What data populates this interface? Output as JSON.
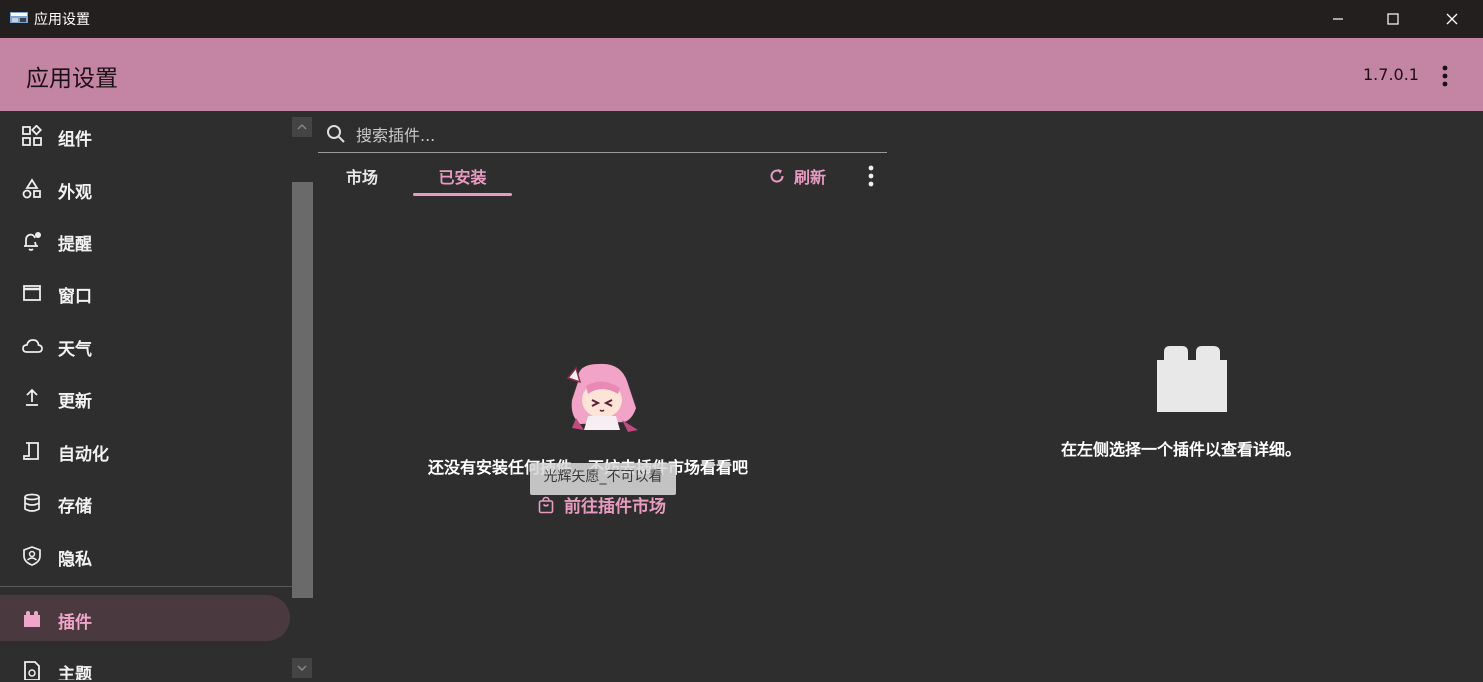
{
  "window": {
    "title": "应用设置"
  },
  "header": {
    "title": "应用设置",
    "version": "1.7.0.1"
  },
  "sidebar": {
    "items": [
      {
        "label": "组件"
      },
      {
        "label": "外观"
      },
      {
        "label": "提醒"
      },
      {
        "label": "窗口"
      },
      {
        "label": "天气"
      },
      {
        "label": "更新"
      },
      {
        "label": "自动化"
      },
      {
        "label": "存储"
      },
      {
        "label": "隐私"
      },
      {
        "label": "插件",
        "active": true
      },
      {
        "label": "主题"
      }
    ]
  },
  "search": {
    "placeholder": "搜索插件..."
  },
  "tabs": [
    {
      "label": "市场"
    },
    {
      "label": "已安装",
      "active": true
    }
  ],
  "toolbar": {
    "refresh_label": "刷新"
  },
  "empty_state": {
    "message": "还没有安装任何插件，不妨去插件市场看看吧",
    "action_label": "前往插件市场",
    "tooltip": "光辉矢愿_不可以看"
  },
  "details": {
    "hint": "在左侧选择一个插件以查看详细。"
  },
  "colors": {
    "accent": "#e89bc0",
    "header_bg": "#c485a5",
    "background": "#2e2e2e",
    "titlebar": "#241f1f"
  },
  "icons": [
    "app-icon",
    "minimize-icon",
    "maximize-icon",
    "close-icon",
    "more-vert-icon",
    "widgets-icon",
    "appearance-icon",
    "notification-icon",
    "window-icon",
    "cloud-icon",
    "update-icon",
    "automation-icon",
    "storage-icon",
    "privacy-icon",
    "plugin-icon",
    "theme-icon",
    "search-icon",
    "refresh-icon",
    "shopping-bag-icon",
    "mascot-image"
  ]
}
